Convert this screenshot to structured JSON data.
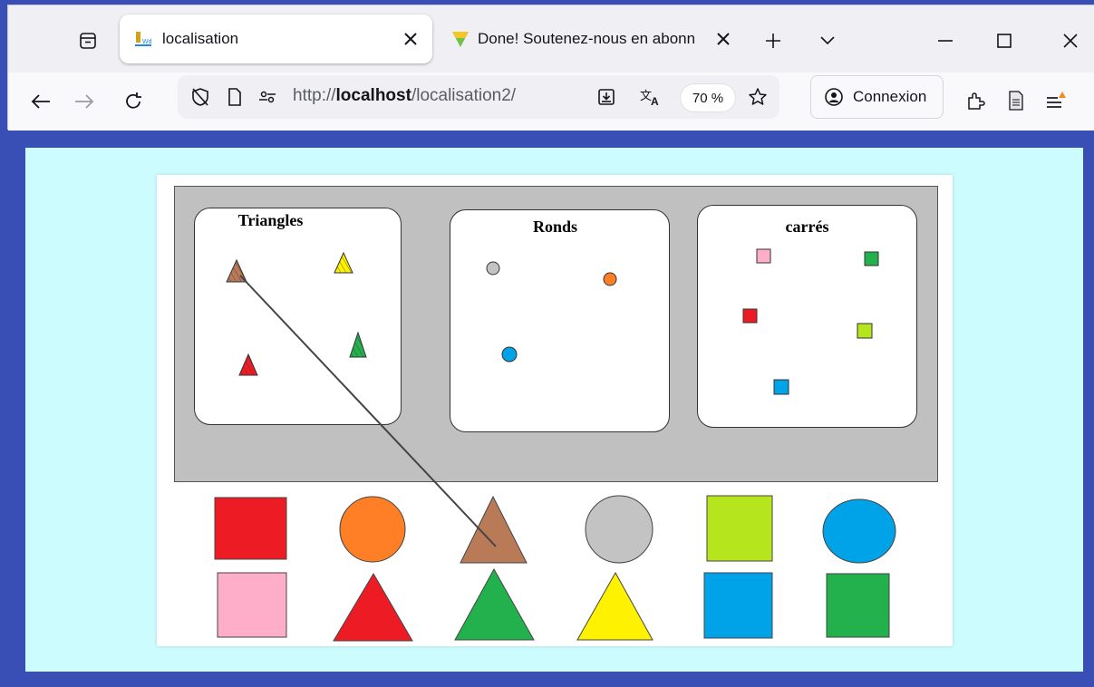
{
  "browser": {
    "tabs": [
      {
        "title": "localisation",
        "active": true
      },
      {
        "title": "Done! Soutenez-nous en abonn",
        "active": false
      }
    ],
    "url": {
      "scheme": "http://",
      "host": "localhost",
      "path": "/localisation2/"
    },
    "zoom": "70 %",
    "account_label": "Connexion"
  },
  "activity": {
    "zones": [
      {
        "title": "Triangles"
      },
      {
        "title": "Ronds"
      },
      {
        "title": "carrés"
      }
    ],
    "shapes_row1": [
      "square-red",
      "circle-orange",
      "triangle-brown",
      "circle-gray",
      "square-lime",
      "circle-blue"
    ],
    "shapes_row2": [
      "square-pink",
      "triangle-red",
      "triangle-green",
      "triangle-yellow",
      "square-blue",
      "square-green"
    ]
  },
  "colors": {
    "page_bg": "#ccfcfe",
    "frame_blue": "#3a4fb5",
    "red": "#ed1c24",
    "orange": "#ff7f27",
    "brown": "#b97a57",
    "gray": "#c3c3c3",
    "lime": "#b5e61d",
    "blue": "#00a2e8",
    "pink": "#ffaec9",
    "green": "#22b14c",
    "yellow": "#fff200"
  }
}
